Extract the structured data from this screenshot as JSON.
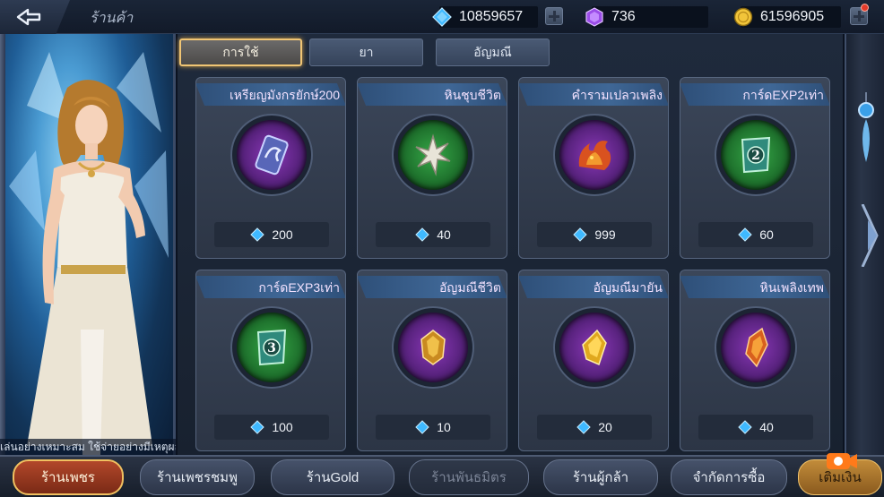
{
  "header": {
    "title": "ร้านค้า",
    "diamonds": "10859657",
    "gems": "736",
    "gold": "61596905"
  },
  "tabs": [
    {
      "label": "การใช้",
      "active": true
    },
    {
      "label": "ยา",
      "active": false
    },
    {
      "label": "อัญมณี",
      "active": false
    }
  ],
  "items": [
    {
      "name": "เหรียญมังกรยักษ์200",
      "price": "200",
      "icon": "dragon-coin-icon",
      "orb": "purple"
    },
    {
      "name": "หินชุบชีวิต",
      "price": "40",
      "icon": "revive-stone-icon",
      "orb": "green"
    },
    {
      "name": "คำรามเปลวเพลิง",
      "price": "999",
      "icon": "flame-beast-icon",
      "orb": "purple"
    },
    {
      "name": "การ์ดEXP2เท่า",
      "price": "60",
      "icon": "exp-card-2x-icon",
      "orb": "green"
    },
    {
      "name": "การ์ดEXP3เท่า",
      "price": "100",
      "icon": "exp-card-3x-icon",
      "orb": "green"
    },
    {
      "name": "อัญมณีชีวิต",
      "price": "10",
      "icon": "life-gem-icon",
      "orb": "purple"
    },
    {
      "name": "อัญมณีมายัน",
      "price": "20",
      "icon": "mayan-gem-icon",
      "orb": "purple"
    },
    {
      "name": "หินเพลิงเทพ",
      "price": "40",
      "icon": "divine-flame-stone-icon",
      "orb": "purple"
    }
  ],
  "notice": "เล่นอย่างเหมาะสม ใช้จ่ายอย่างมีเหตุผล",
  "bottom_nav": [
    {
      "label": "ร้านเพชร",
      "state": "active"
    },
    {
      "label": "ร้านเพชรชมพู",
      "state": "normal"
    },
    {
      "label": "ร้านGold",
      "state": "normal"
    },
    {
      "label": "ร้านพันธมิตร",
      "state": "disabled"
    },
    {
      "label": "ร้านผู้กล้า",
      "state": "normal"
    },
    {
      "label": "จำกัดการซื้อ",
      "state": "normal"
    },
    {
      "label": "เติมเงิน",
      "state": "topup"
    }
  ],
  "colors": {
    "diamond": "#3fb9ff",
    "gem": "#b46cff",
    "gold": "#f2c53a",
    "tab_active_border": "#f0c574",
    "nav_active": "#b2472a"
  }
}
